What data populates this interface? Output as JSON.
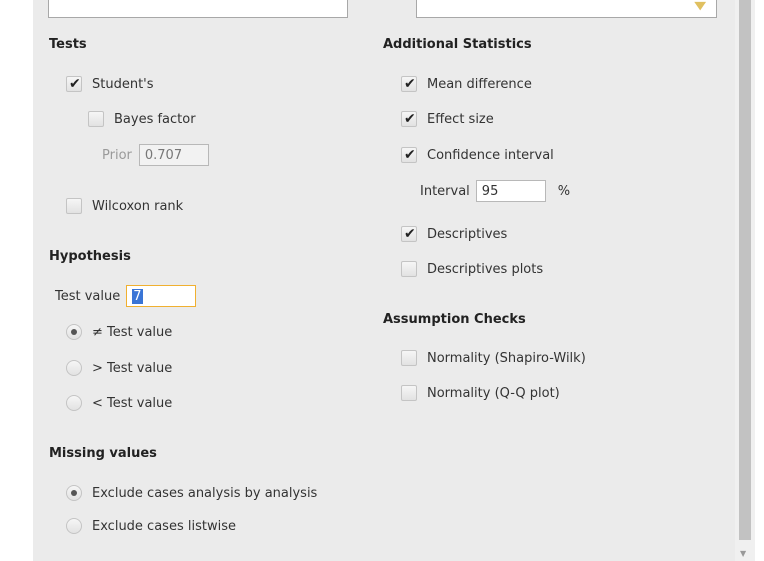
{
  "tests": {
    "heading": "Tests",
    "students": {
      "label": "Student's",
      "checked": true
    },
    "bayes": {
      "label": "Bayes factor",
      "checked": false
    },
    "prior": {
      "label": "Prior",
      "value": "0.707"
    },
    "wilcoxon": {
      "label": "Wilcoxon rank",
      "checked": false
    }
  },
  "hypothesis": {
    "heading": "Hypothesis",
    "test_value_label": "Test value",
    "test_value": "7",
    "options": [
      {
        "label": "≠ Test value",
        "selected": true
      },
      {
        "label": "> Test value",
        "selected": false
      },
      {
        "label": "< Test value",
        "selected": false
      }
    ]
  },
  "missing": {
    "heading": "Missing values",
    "options": [
      {
        "label": "Exclude cases analysis by analysis",
        "selected": true
      },
      {
        "label": "Exclude cases listwise",
        "selected": false
      }
    ]
  },
  "additional": {
    "heading": "Additional Statistics",
    "mean_difference": {
      "label": "Mean difference",
      "checked": true
    },
    "effect_size": {
      "label": "Effect size",
      "checked": true
    },
    "confidence_interval": {
      "label": "Confidence interval",
      "checked": true
    },
    "interval": {
      "label": "Interval",
      "value": "95",
      "unit": "%"
    },
    "descriptives": {
      "label": "Descriptives",
      "checked": true
    },
    "descriptives_plots": {
      "label": "Descriptives plots",
      "checked": false
    }
  },
  "assumptions": {
    "heading": "Assumption Checks",
    "normality_sw": {
      "label": "Normality (Shapiro-Wilk)",
      "checked": false
    },
    "normality_qq": {
      "label": "Normality (Q-Q plot)",
      "checked": false
    }
  },
  "icons": {
    "check": "✔",
    "dropdown": "▼",
    "scroll_down": "▼"
  },
  "colors": {
    "panel": "#ebebeb",
    "focus_border": "#f0b030",
    "selection": "#3a75d6"
  }
}
